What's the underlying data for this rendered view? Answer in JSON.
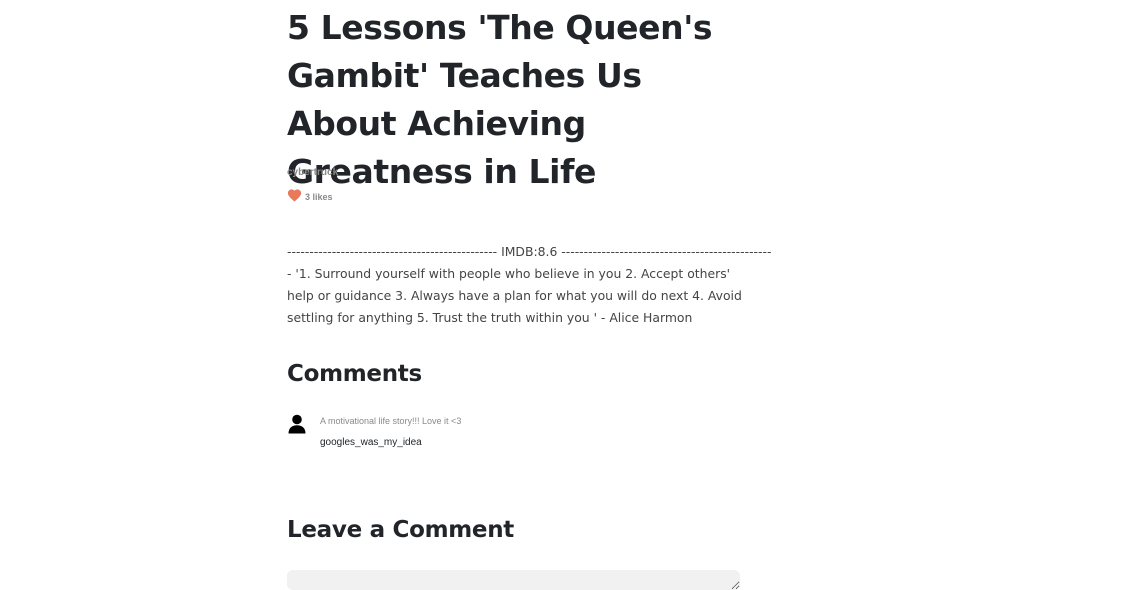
{
  "article": {
    "title": "5 Lessons 'The Queen's Gambit' Teaches Us About Achieving Greatness in Life",
    "author": "cybertruck",
    "likes": "3 likes",
    "body_lines": [
      "----------------------------------------------- IMDB:8.6 -----------------------------------------------",
      "- '1. Surround yourself with people who believe in you 2. Accept others'",
      "help or guidance 3. Always have a plan for what you will do next 4. Avoid",
      "settling for anything 5. Trust the truth within you ' - Alice Harmon"
    ]
  },
  "comments": {
    "heading": "Comments",
    "items": [
      {
        "text": "A motivational life story!!! Love it <3",
        "user": "googles_was_my_idea"
      }
    ]
  },
  "leave_comment": {
    "heading": "Leave a Comment"
  },
  "colors": {
    "heart": "#e8795a",
    "muted_text": "#8a8a8a",
    "heading_text": "#212529"
  },
  "icons": {
    "like": "heart-icon",
    "avatar": "user-avatar-icon"
  }
}
